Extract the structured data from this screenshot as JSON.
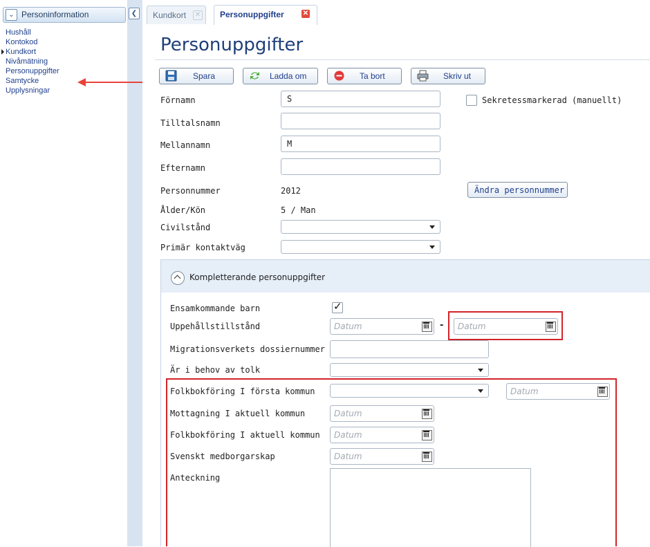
{
  "nav": {
    "header": "Personinformation",
    "items": [
      {
        "label": "Hushåll",
        "current": false
      },
      {
        "label": "Kontokod",
        "current": false
      },
      {
        "label": "Kundkort",
        "current": true
      },
      {
        "label": "Nivåmätning",
        "current": false
      },
      {
        "label": "Personuppgifter",
        "current": false
      },
      {
        "label": "Samtycke",
        "current": false
      },
      {
        "label": "Upplysningar",
        "current": false
      }
    ]
  },
  "tabs": [
    {
      "label": "Kundkort",
      "active": false
    },
    {
      "label": "Personuppgifter",
      "active": true
    }
  ],
  "page": {
    "title": "Personuppgifter"
  },
  "toolbar": {
    "save": "Spara",
    "reload": "Ladda om",
    "delete": "Ta bort",
    "print": "Skriv ut"
  },
  "form": {
    "fornamn": {
      "label": "Förnamn",
      "value": "S"
    },
    "tilltalsnamn": {
      "label": "Tilltalsnamn",
      "value": ""
    },
    "mellannamn": {
      "label": "Mellannamn",
      "value": "M"
    },
    "efternamn": {
      "label": "Efternamn",
      "value": ""
    },
    "personnummer": {
      "label": "Personnummer",
      "value": "2012"
    },
    "alder_kon": {
      "label": "Ålder/Kön",
      "value": "5 / Man"
    },
    "civilstand": {
      "label": "Civilstånd",
      "value": ""
    },
    "kontaktvag": {
      "label": "Primär kontaktväg",
      "value": ""
    },
    "sekretess": {
      "label": "Sekretessmarkerad (manuellt)",
      "checked": false
    },
    "andra_pnr_button": "Ändra personnummer"
  },
  "supplement": {
    "title": "Kompletterande personuppgifter",
    "ensamkommande": {
      "label": "Ensamkommande barn",
      "checked": true
    },
    "uppehall": {
      "label": "Uppehållstillstånd",
      "from_placeholder": "Datum",
      "to_placeholder": "Datum",
      "separator": "-"
    },
    "dossier": {
      "label": "Migrationsverkets dossiernummer",
      "value": ""
    },
    "tolk": {
      "label": "Är i behov av tolk",
      "value": ""
    },
    "folkbok_forsta": {
      "label": "Folkbokföring I första kommun",
      "value": "",
      "date_placeholder": "Datum"
    },
    "mottagning": {
      "label": "Mottagning I aktuell kommun",
      "date_placeholder": "Datum"
    },
    "folkbok_aktuell": {
      "label": "Folkbokföring I aktuell kommun",
      "date_placeholder": "Datum"
    },
    "medborgarskap": {
      "label": "Svenskt medborgarskap",
      "date_placeholder": "Datum"
    },
    "anteckning": {
      "label": "Anteckning",
      "value": ""
    }
  },
  "colors": {
    "annotation_red": "#d2232a",
    "arrow_red": "#e8433a",
    "link_blue": "#1f3f8c",
    "title_blue": "#1f3f7a"
  }
}
